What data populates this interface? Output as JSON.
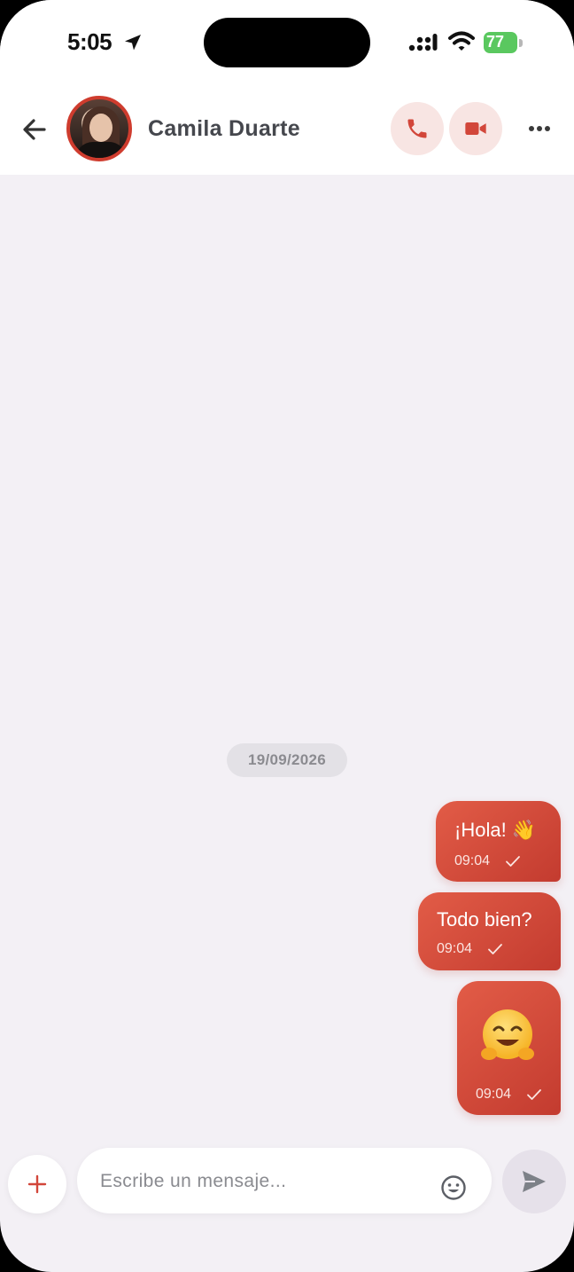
{
  "status_bar": {
    "time": "5:05",
    "battery": "77",
    "icons": [
      "location-arrow-icon",
      "signal-icon",
      "wifi-icon",
      "battery-charging-icon"
    ]
  },
  "header": {
    "contact_name": "Camila Duarte",
    "icons": [
      "back-arrow-icon",
      "phone-icon",
      "video-camera-icon",
      "more-horizontal-icon"
    ]
  },
  "chat": {
    "date_chip": "19/09/2026",
    "messages": [
      {
        "text": "¡Hola! 👋",
        "time": "09:04",
        "status": "sent",
        "direction": "outgoing"
      },
      {
        "text": "Todo bien?",
        "time": "09:04",
        "status": "sent",
        "direction": "outgoing"
      },
      {
        "text": "🤗",
        "time": "09:04",
        "status": "sent",
        "direction": "outgoing",
        "emoji_only": true
      }
    ]
  },
  "composer": {
    "placeholder": "Escribe un mensaje...",
    "value": "",
    "icons": [
      "plus-icon",
      "smiley-icon",
      "send-icon"
    ]
  },
  "colors": {
    "accent": "#d2463a",
    "bubble_start": "#e25c47",
    "bubble_end": "#c33b2f",
    "accent_soft": "#f8e5e3",
    "chat_background": "#f3f0f5",
    "header_background": "#ffffff",
    "battery": "#5ac85f"
  }
}
